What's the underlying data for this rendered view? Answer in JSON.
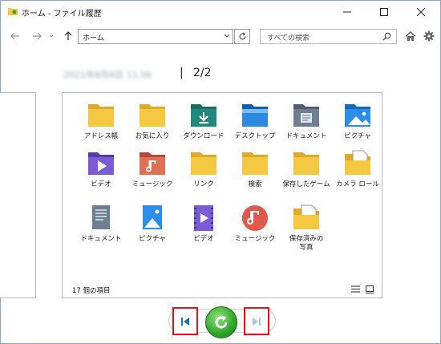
{
  "window": {
    "title": "ホーム - ファイル履歴"
  },
  "nav": {
    "address": "ホーム",
    "search_placeholder": "すべての検索"
  },
  "history": {
    "timestamp_blurred": "2021年8月8日 11:56",
    "separator": "|",
    "position": "2/2"
  },
  "items": [
    {
      "label": "アドレス帳",
      "icon": "folder-icon"
    },
    {
      "label": "お気に入り",
      "icon": "folder-icon"
    },
    {
      "label": "ダウンロード",
      "icon": "downloads-folder-icon"
    },
    {
      "label": "デスクトップ",
      "icon": "desktop-folder-icon"
    },
    {
      "label": "ドキュメント",
      "icon": "documents-folder-icon"
    },
    {
      "label": "ピクチャ",
      "icon": "pictures-folder-icon"
    },
    {
      "label": "ビデオ",
      "icon": "videos-folder-icon"
    },
    {
      "label": "ミュージック",
      "icon": "music-folder-icon"
    },
    {
      "label": "リンク",
      "icon": "folder-icon"
    },
    {
      "label": "検索",
      "icon": "folder-icon"
    },
    {
      "label": "保存したゲーム",
      "icon": "folder-icon"
    },
    {
      "label": "カメラ ロール",
      "icon": "folder-with-document-icon"
    },
    {
      "label": "ドキュメント",
      "icon": "documents-library-icon"
    },
    {
      "label": "ピクチャ",
      "icon": "pictures-library-icon"
    },
    {
      "label": "ビデオ",
      "icon": "videos-library-icon"
    },
    {
      "label": "ミュージック",
      "icon": "music-library-icon"
    },
    {
      "label": "保存済みの写真",
      "icon": "folder-with-document-icon"
    }
  ],
  "status": {
    "item_count": "17 個の項目"
  },
  "colors": {
    "highlight_border": "#e0141a",
    "restore_green": "#2fa62a",
    "folder_yellow": "#f5c842"
  }
}
